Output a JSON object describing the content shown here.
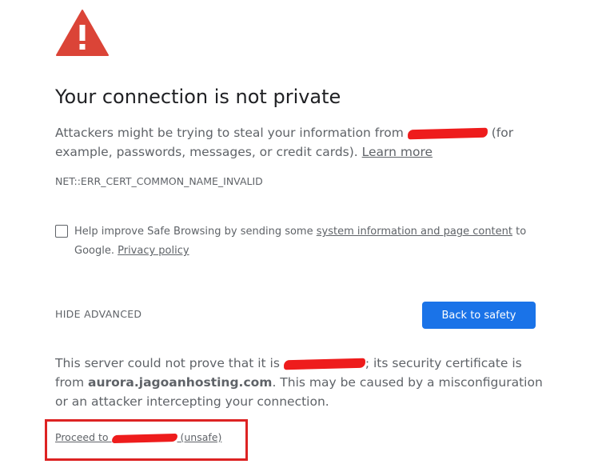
{
  "icon": "warning-triangle-icon",
  "colors": {
    "warning_red": "#db4437",
    "button_blue": "#1a73e8",
    "annotation_red": "#dd2323",
    "redaction_red": "#ee1c1c"
  },
  "heading": "Your connection is not private",
  "main": {
    "text_before": "Attackers might be trying to steal your information from ",
    "text_after": " (for example, passwords, messages, or credit cards). ",
    "learn_more": "Learn more"
  },
  "error_code": "NET::ERR_CERT_COMMON_NAME_INVALID",
  "optin": {
    "text_before": "Help improve Safe Browsing by sending some ",
    "link1": "system information and page content",
    "text_middle": " to Google. ",
    "link2": "Privacy policy"
  },
  "hide_advanced": "HIDE ADVANCED",
  "back_button": "Back to safety",
  "details": {
    "text_before": "This server could not prove that it is ",
    "text_middle": "; its security certificate is from ",
    "host": "aurora.jagoanhosting.com",
    "text_after": ". This may be caused by a misconfiguration or an attacker intercepting your connection."
  },
  "proceed": {
    "text_before": "Proceed to ",
    "text_after": " (unsafe)"
  }
}
